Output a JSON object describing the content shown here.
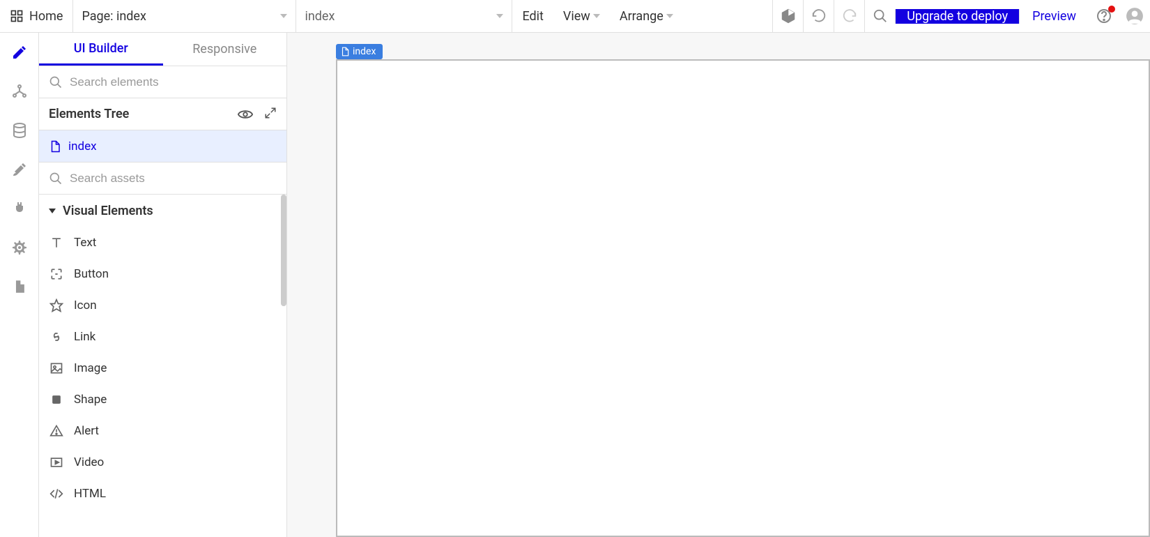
{
  "topbar": {
    "home_label": "Home",
    "page_label": "Page: index",
    "element_label": "index",
    "edit_label": "Edit",
    "view_label": "View",
    "arrange_label": "Arrange",
    "upgrade_label": "Upgrade to deploy",
    "preview_label": "Preview"
  },
  "sidebar": {
    "tabs": {
      "ui_builder": "UI Builder",
      "responsive": "Responsive"
    },
    "search_elements_placeholder": "Search elements",
    "search_assets_placeholder": "Search assets",
    "tree_header": "Elements Tree",
    "tree_items": [
      {
        "label": "index"
      }
    ],
    "section_label": "Visual Elements",
    "elements": [
      {
        "label": "Text",
        "icon": "text-icon"
      },
      {
        "label": "Button",
        "icon": "button-icon"
      },
      {
        "label": "Icon",
        "icon": "star-icon"
      },
      {
        "label": "Link",
        "icon": "link-icon"
      },
      {
        "label": "Image",
        "icon": "image-icon"
      },
      {
        "label": "Shape",
        "icon": "shape-icon"
      },
      {
        "label": "Alert",
        "icon": "alert-icon"
      },
      {
        "label": "Video",
        "icon": "video-icon"
      },
      {
        "label": "HTML",
        "icon": "html-icon"
      }
    ]
  },
  "canvas": {
    "open_page": "index"
  },
  "colors": {
    "accent": "#1300e0",
    "canvas_tab": "#3a7ee0",
    "notification_dot": "#e41010"
  }
}
